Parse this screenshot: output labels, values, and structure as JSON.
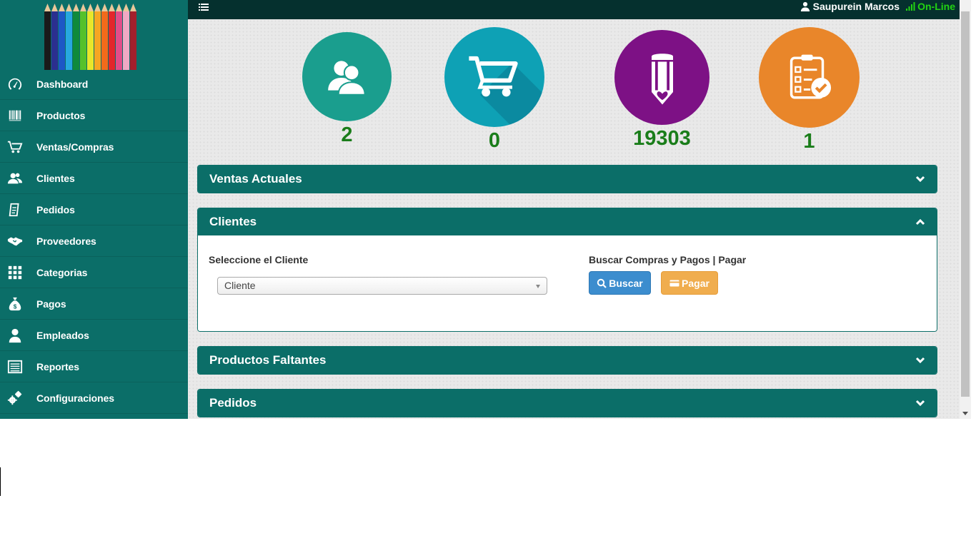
{
  "sidebar": {
    "logo_icon": "colored-pencils-logo",
    "items": [
      {
        "label": "Dashboard",
        "icon": "dashboard-icon"
      },
      {
        "label": "Productos",
        "icon": "barcode-icon"
      },
      {
        "label": "Ventas/Compras",
        "icon": "cart-icon"
      },
      {
        "label": "Clientes",
        "icon": "users-icon"
      },
      {
        "label": "Pedidos",
        "icon": "clipboard-icon"
      },
      {
        "label": "Proveedores",
        "icon": "handshake-icon"
      },
      {
        "label": "Categorias",
        "icon": "grid-icon"
      },
      {
        "label": "Pagos",
        "icon": "money-bag-icon"
      },
      {
        "label": "Empleados",
        "icon": "user-icon"
      },
      {
        "label": "Reportes",
        "icon": "list-icon"
      },
      {
        "label": "Configuraciones",
        "icon": "gears-icon"
      }
    ]
  },
  "topbar": {
    "user_name": "Saupurein Marcos",
    "status": "On-Line",
    "status_color": "#22d312"
  },
  "stats": [
    {
      "value": "2",
      "icon": "users-icon",
      "color": "#1a9e8e"
    },
    {
      "value": "0",
      "icon": "cart-icon",
      "color": "#0ea1b5"
    },
    {
      "value": "19303",
      "icon": "pencil-icon",
      "color": "#7d1185"
    },
    {
      "value": "1",
      "icon": "checklist-icon",
      "color": "#e9862a"
    }
  ],
  "panels": {
    "ventas_actuales": {
      "title": "Ventas Actuales"
    },
    "clientes": {
      "title": "Clientes",
      "select_label": "Seleccione el Cliente",
      "select_value": "Cliente",
      "actions_label": "Buscar Compras y Pagos | Pagar",
      "buscar_label": "Buscar",
      "pagar_label": "Pagar"
    },
    "productos_faltantes": {
      "title": "Productos Faltantes"
    },
    "pedidos": {
      "title": "Pedidos"
    }
  },
  "colors": {
    "sidebar": "#0b6e68",
    "topbar": "#05302e",
    "count_text": "#1a7d1a"
  }
}
